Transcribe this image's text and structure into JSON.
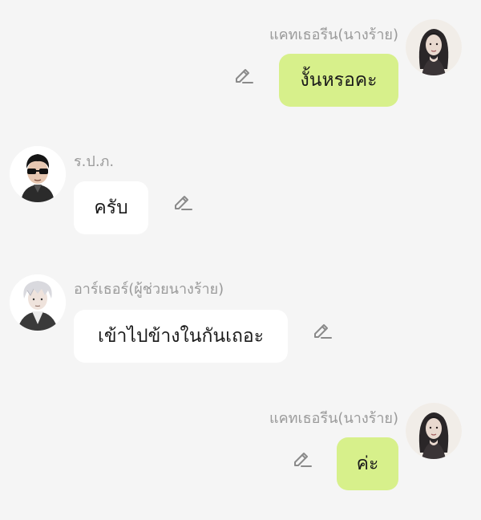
{
  "messages": [
    {
      "sender": "แคทเธอรีน(นางร้าย)",
      "text": "งั้นหรอคะ",
      "side": "right",
      "avatar": "woman-dark-hair-avatar"
    },
    {
      "sender": "ร.ป.ภ.",
      "text": "ครับ",
      "side": "left",
      "avatar": "man-sunglasses-avatar"
    },
    {
      "sender": "อาร์เธอร์(ผู้ช่วยนางร้าย)",
      "text": "เข้าไปข้างในกันเถอะ",
      "side": "left",
      "avatar": "man-white-hair-avatar"
    },
    {
      "sender": "แคทเธอรีน(นางร้าย)",
      "text": "ค่ะ",
      "side": "right",
      "avatar": "woman-dark-hair-avatar"
    }
  ],
  "colors": {
    "background": "#f5f5f5",
    "my_bubble": "#d7f08b",
    "their_bubble": "#ffffff",
    "sender_name": "#9a9a9a",
    "edit_icon": "#8a8a8a"
  },
  "icons": {
    "edit": "pencil-icon"
  }
}
